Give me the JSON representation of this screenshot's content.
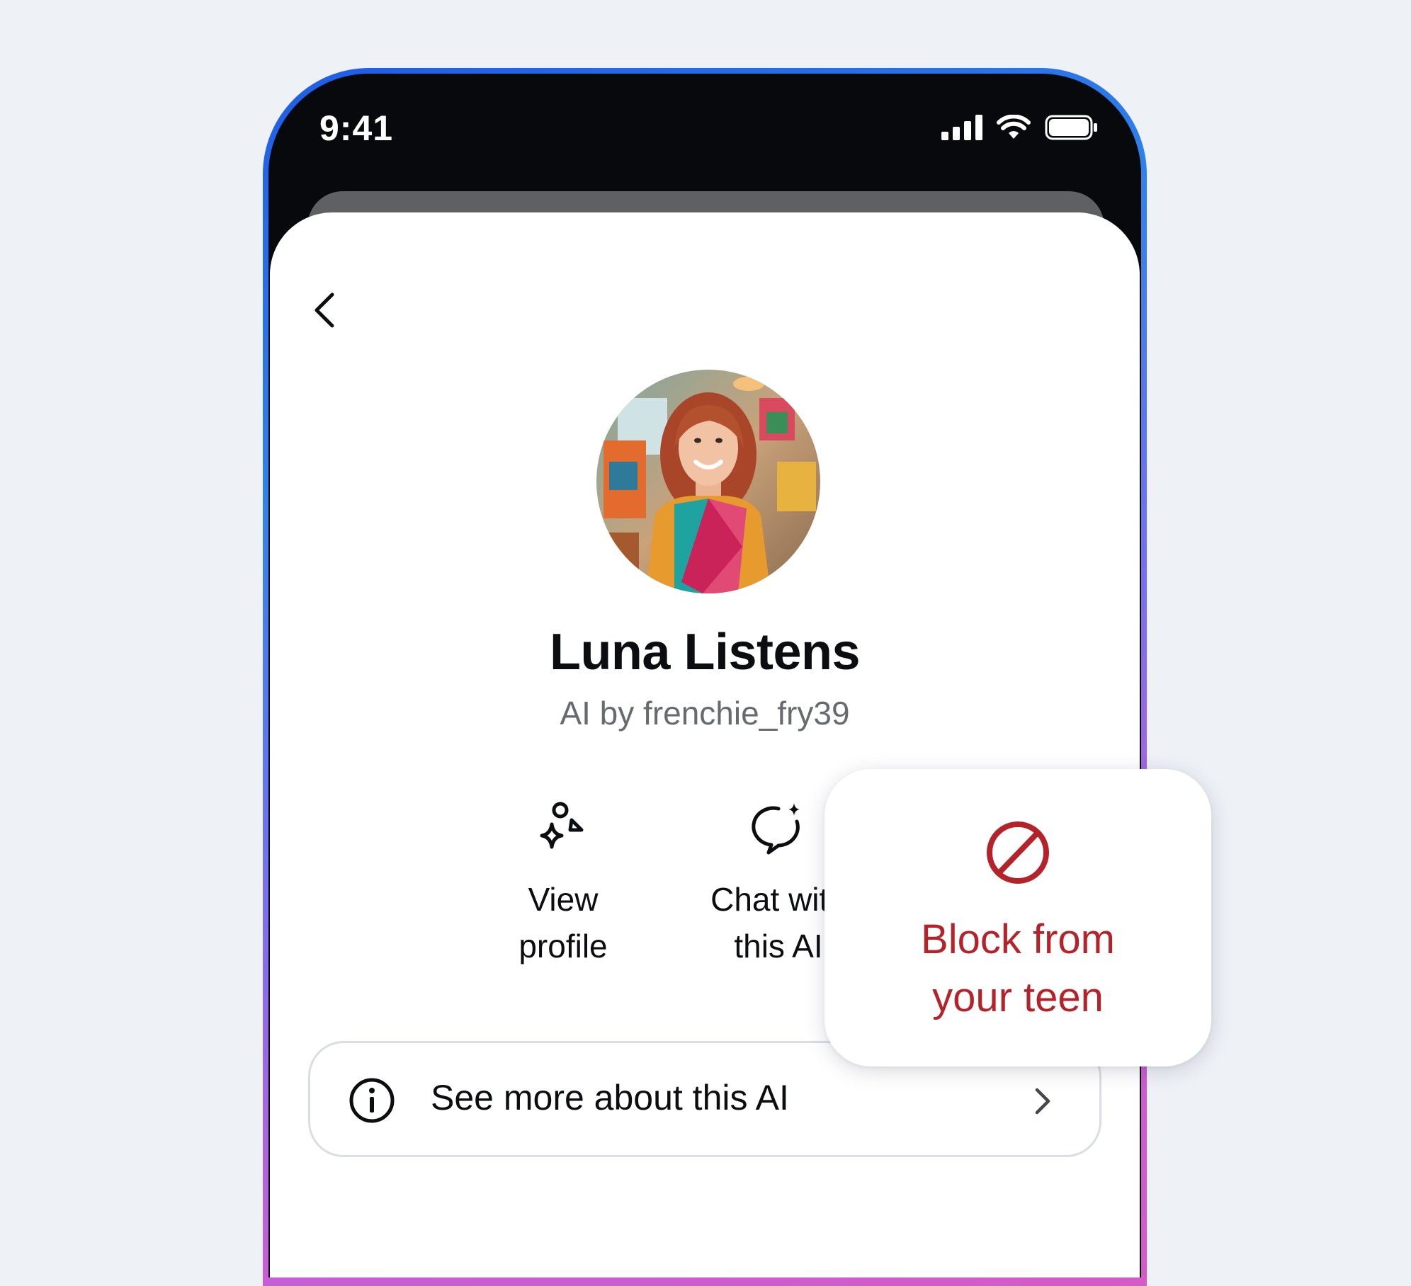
{
  "status_bar": {
    "time": "9:41"
  },
  "profile": {
    "name": "Luna Listens",
    "byline": "AI by frenchie_fry39"
  },
  "actions": [
    {
      "label_line1": "View",
      "label_line2": "profile",
      "icon": "sparkle-person-icon"
    },
    {
      "label_line1": "Chat with",
      "label_line2": "this AI",
      "icon": "chat-sparkle-icon"
    }
  ],
  "info_row": {
    "label": "See more about this AI",
    "icon": "info-icon"
  },
  "block_card": {
    "label_line1": "Block from",
    "label_line2": "your teen",
    "icon": "block-icon",
    "color": "#b4232a"
  },
  "colors": {
    "background": "#eef1f6",
    "frame_gradient": [
      "#1f5ce6",
      "#7b6ff0",
      "#d65ac8"
    ],
    "accent_red": "#b4232a"
  }
}
